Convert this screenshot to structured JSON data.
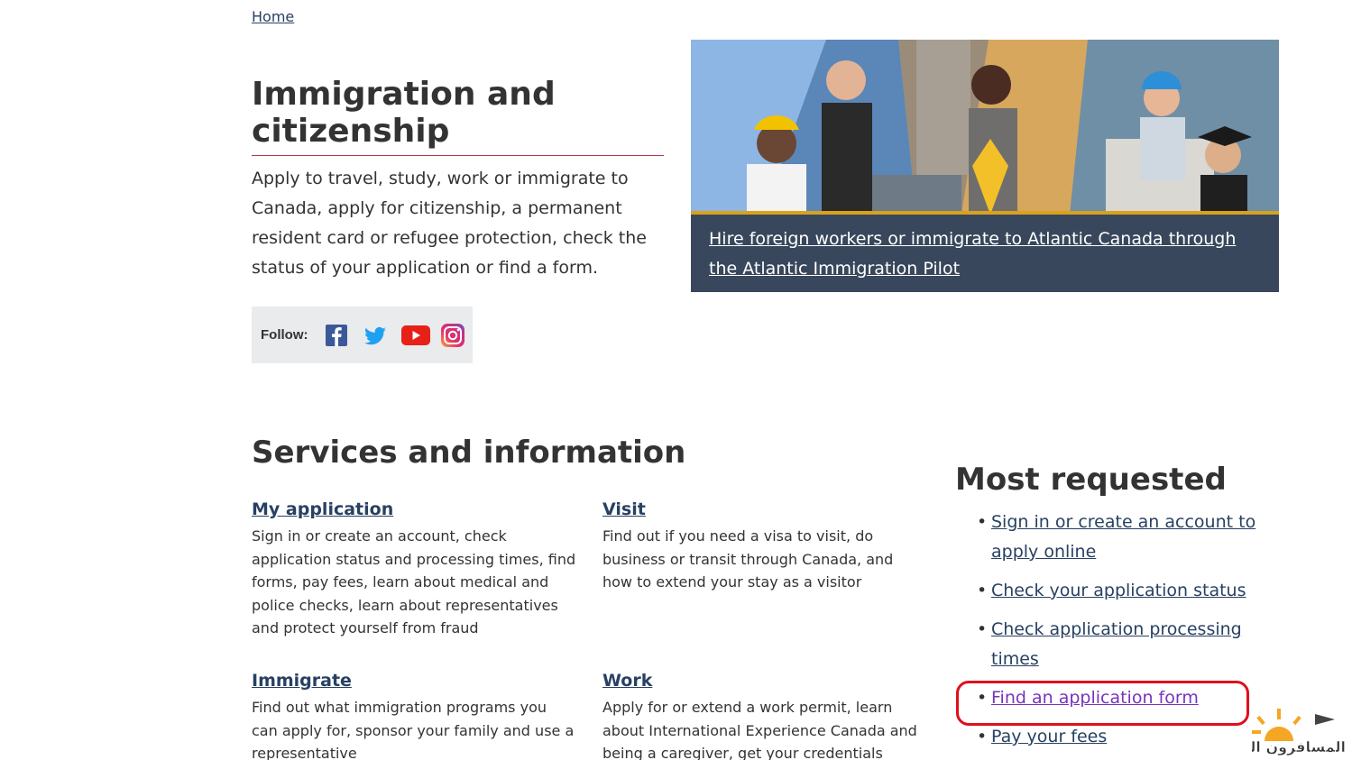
{
  "breadcrumb": {
    "home": "Home"
  },
  "header": {
    "title": "Immigration and citizenship",
    "intro": "Apply to travel, study, work or immigrate to Canada, apply for citizenship, a permanent resident card or refugee protection, check the status of your application or find a form."
  },
  "follow": {
    "label": "Follow:",
    "icons": [
      "facebook-icon",
      "twitter-icon",
      "youtube-icon",
      "instagram-icon"
    ]
  },
  "promo": {
    "link": "Hire foreign workers or immigrate to Atlantic Canada through the Atlantic Immigration Pilot"
  },
  "services": {
    "title": "Services and information",
    "items": [
      {
        "title": "My application",
        "desc": "Sign in or create an account, check application status and processing times, find forms, pay fees, learn about medical and police checks, learn about representatives and protect yourself from fraud"
      },
      {
        "title": "Visit",
        "desc": "Find out if you need a visa to visit, do business or transit through Canada, and how to extend your stay as a visitor"
      },
      {
        "title": "Immigrate",
        "desc": "Find out what immigration programs you can apply for, sponsor your family and use a representative"
      },
      {
        "title": "Work",
        "desc": "Apply for or extend a work permit, learn about International Experience Canada and being a caregiver, get your credentials"
      }
    ]
  },
  "most_requested": {
    "title": "Most requested",
    "items": [
      "Sign in or create an account to apply online",
      "Check your application status",
      "Check application processing times",
      "Find an application form",
      "Pay your fees"
    ]
  },
  "watermark": {
    "text": "المسافرون العرب"
  },
  "colors": {
    "link": "#284162",
    "visited": "#7834bc",
    "accent_rule": "#af3c43",
    "promo_bg": "#38475c",
    "annotation": "#e0101c"
  }
}
